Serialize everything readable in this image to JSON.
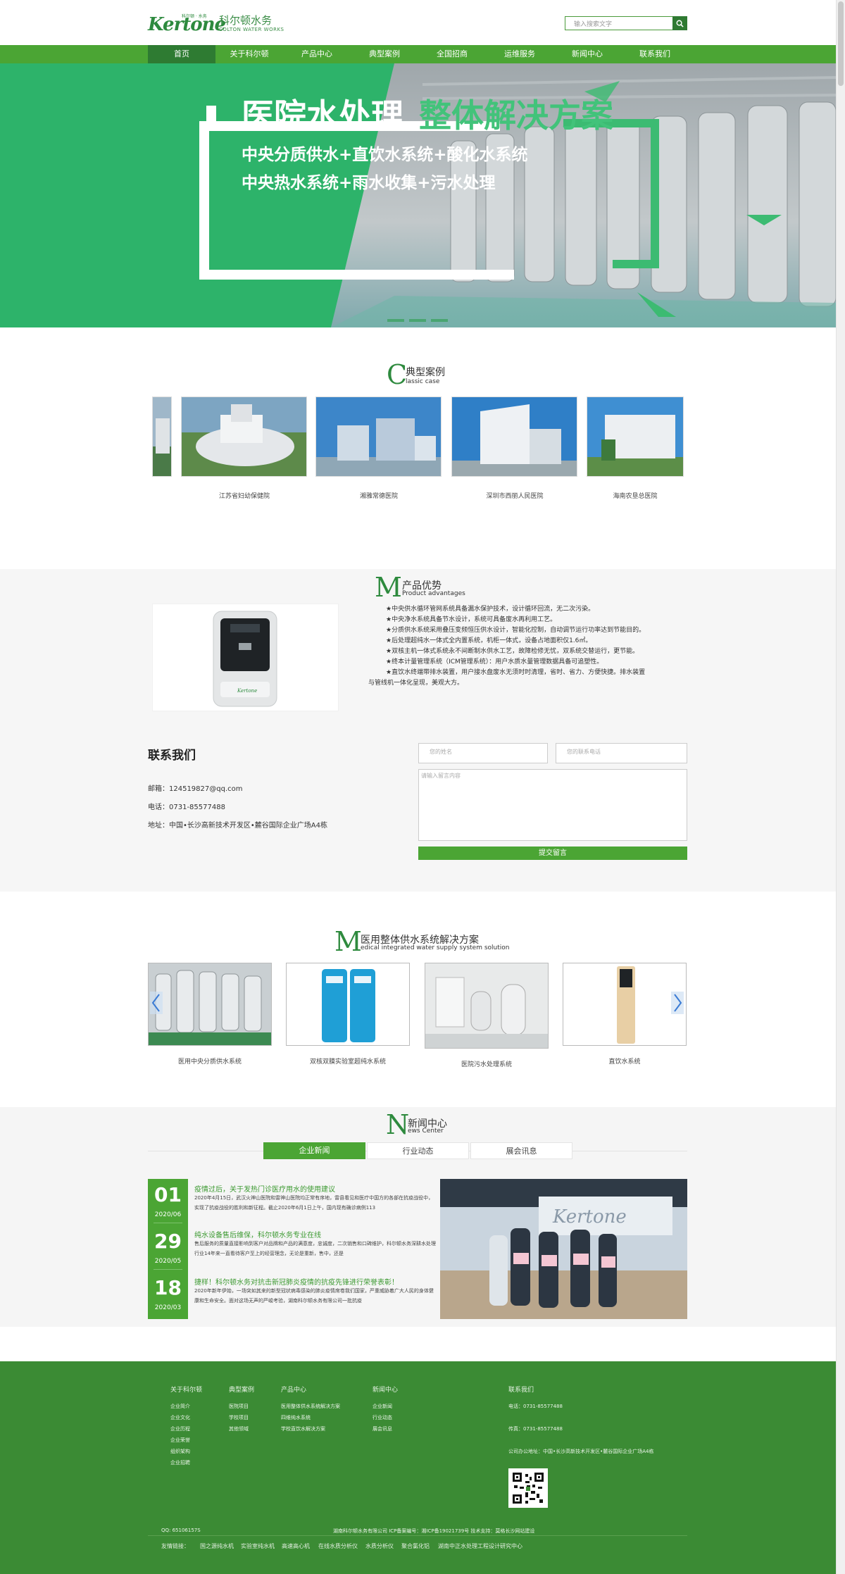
{
  "header": {
    "logo_mark": "Kertone",
    "logo_tag": "科尔顿 · 水务",
    "logo_cn": "科尔顿水务",
    "logo_en": "COLTON WATER WORKS",
    "search_placeholder": "输入搜索文字"
  },
  "nav": [
    "首页",
    "关于科尔顿",
    "产品中心",
    "典型案例",
    "全国招商",
    "运维服务",
    "新闻中心",
    "联系我们"
  ],
  "banner": {
    "title_a": "医院水处理",
    "title_b": "整体解决方案",
    "line1": "中央分质供水+直饮水系统+酸化水系统",
    "line2": "中央热水系统+雨水收集+污水处理"
  },
  "cases": {
    "big": "C",
    "cn": "典型案例",
    "en": "lassic case",
    "items": [
      "江苏省妇幼保健院",
      "湘雅常德医院",
      "深圳市西丽人民医院",
      "海南农垦总医院"
    ]
  },
  "advantages": {
    "big": "M",
    "cn": "产品优势",
    "en": "Product advantages",
    "lines": [
      "★中央供水循环管网系统具备漏水保护技术，设计循环回流，无二次污染。",
      "★中央净水系统具备节水设计，系统可具备废水再利用工艺。",
      "★分质供水系统采用叠压变频恒压供水设计，智能化控制，自动调节运行功率达到节能目的。",
      "★后处理超纯水一体式全内置系统，机柜一体式，设备占地面积仅1.6㎡。",
      "★双核主机一体式系统永不间断制水供水工艺，故障检修无忧，双系统交替运行，更节能。",
      "★终本计量管理系统（ICM管理系统）：用户水质水量管理数据具备可追塑性。",
      "★直饮水终端带排水装置，用户接水盘废水无须时时清理，省时、省力、方便快捷。排水装置",
      "与管线机一体化呈现，美观大方。"
    ]
  },
  "contact": {
    "title": "联系我们",
    "email": "邮箱：124519827@qq.com",
    "phone": "电话：0731-85577488",
    "address": "地址：中国•长沙高新技术开发区•麓谷国际企业广场A4栋",
    "name_ph": "您的姓名",
    "phone_ph": "您的联系电话",
    "msg_ph": "请输入留言内容",
    "submit": "提交留言"
  },
  "solutions": {
    "big": "M",
    "cn": "医用整体供水系统解决方案",
    "en": "edical integrated water supply system solution",
    "items": [
      "医用中央分质供水系统",
      "双核双膜实验室超纯水系统",
      "医院污水处理系统",
      "直饮水系统"
    ]
  },
  "news": {
    "big": "N",
    "cn": "新闻中心",
    "en": "ews Center",
    "tabs": [
      "企业新闻",
      "行业动态",
      "展会讯息"
    ],
    "items": [
      {
        "day": "01",
        "ym": "2020/06",
        "title": "疫情过后，关于发热门诊医疗用水的使用建议",
        "desc": "2020年4月15日，武汉火神山医院和雷神山医院均正常有序地，雷县看见和医疗中国方的各部在抗疫战役中，实现了抗疫战役的胜利和新征程。截止2020年6月1日上午，国内现有确诊病例113"
      },
      {
        "day": "29",
        "ym": "2020/05",
        "title": "纯水设备售后维保，科尔顿水务专业在线",
        "desc": "售后服务的质量直接影响到客户对品牌和产品的满意度，忠诚度，二次销售和口碑维护，科尔顿水务深耕水处理行业14年来一直看待客户至上的经营理念，无论是重新，售中，还是"
      },
      {
        "day": "18",
        "ym": "2020/03",
        "title": "捷样！科尔顿水务对抗击新冠肺炎疫情的抗疫先锋进行荣誉表彰！",
        "desc": "2020年新年伊始，一场突如其来的新型冠状病毒感染的肺炎疫情席卷我们国家，严重威胁着广大人民的身体健康和生命安全。面对这场无声的严峻考验，湖南科尔顿水务有限公司一批抗疫"
      }
    ]
  },
  "footer": {
    "columns": [
      {
        "head": "关于科尔顿",
        "items": [
          "企业简介",
          "企业文化",
          "企业历程",
          "企业荣誉",
          "组织架构",
          "企业招聘"
        ]
      },
      {
        "head": "典型案例",
        "items": [
          "医院项目",
          "学校项目",
          "其他领域"
        ]
      },
      {
        "head": "产品中心",
        "items": [
          "医用整体供水系统解决方案",
          "四维纯水系统",
          "学校直饮水解决方案"
        ]
      },
      {
        "head": "新闻中心",
        "items": [
          "企业新闻",
          "行业动态",
          "展会讯息"
        ]
      }
    ],
    "contact_head": "联系我们",
    "tel": "电话：0731-85577488",
    "fax": "传真：0731-85577488",
    "office": "公司办公地址：中国•长沙高新技术开发区•麓谷国际企业广场A4栋",
    "qq": "QQ: 65106157S",
    "copyright": "湖南科尔顿水务有限公司  ICP备案编号：湘ICP备19021739号  技术支持：莫格长沙网站建设",
    "links_label": "友情链接：",
    "links": [
      "国之源纯水机",
      "实验室纯水机",
      "高速高心机",
      "在线水质分析仪",
      "水质分析仪",
      "聚合氯化铝",
      "湖南中正水处理工程设计研究中心"
    ]
  },
  "colors": {
    "brand_green": "#4ba534",
    "dark_green": "#2e7b32",
    "footer_green": "#3b8b34"
  }
}
